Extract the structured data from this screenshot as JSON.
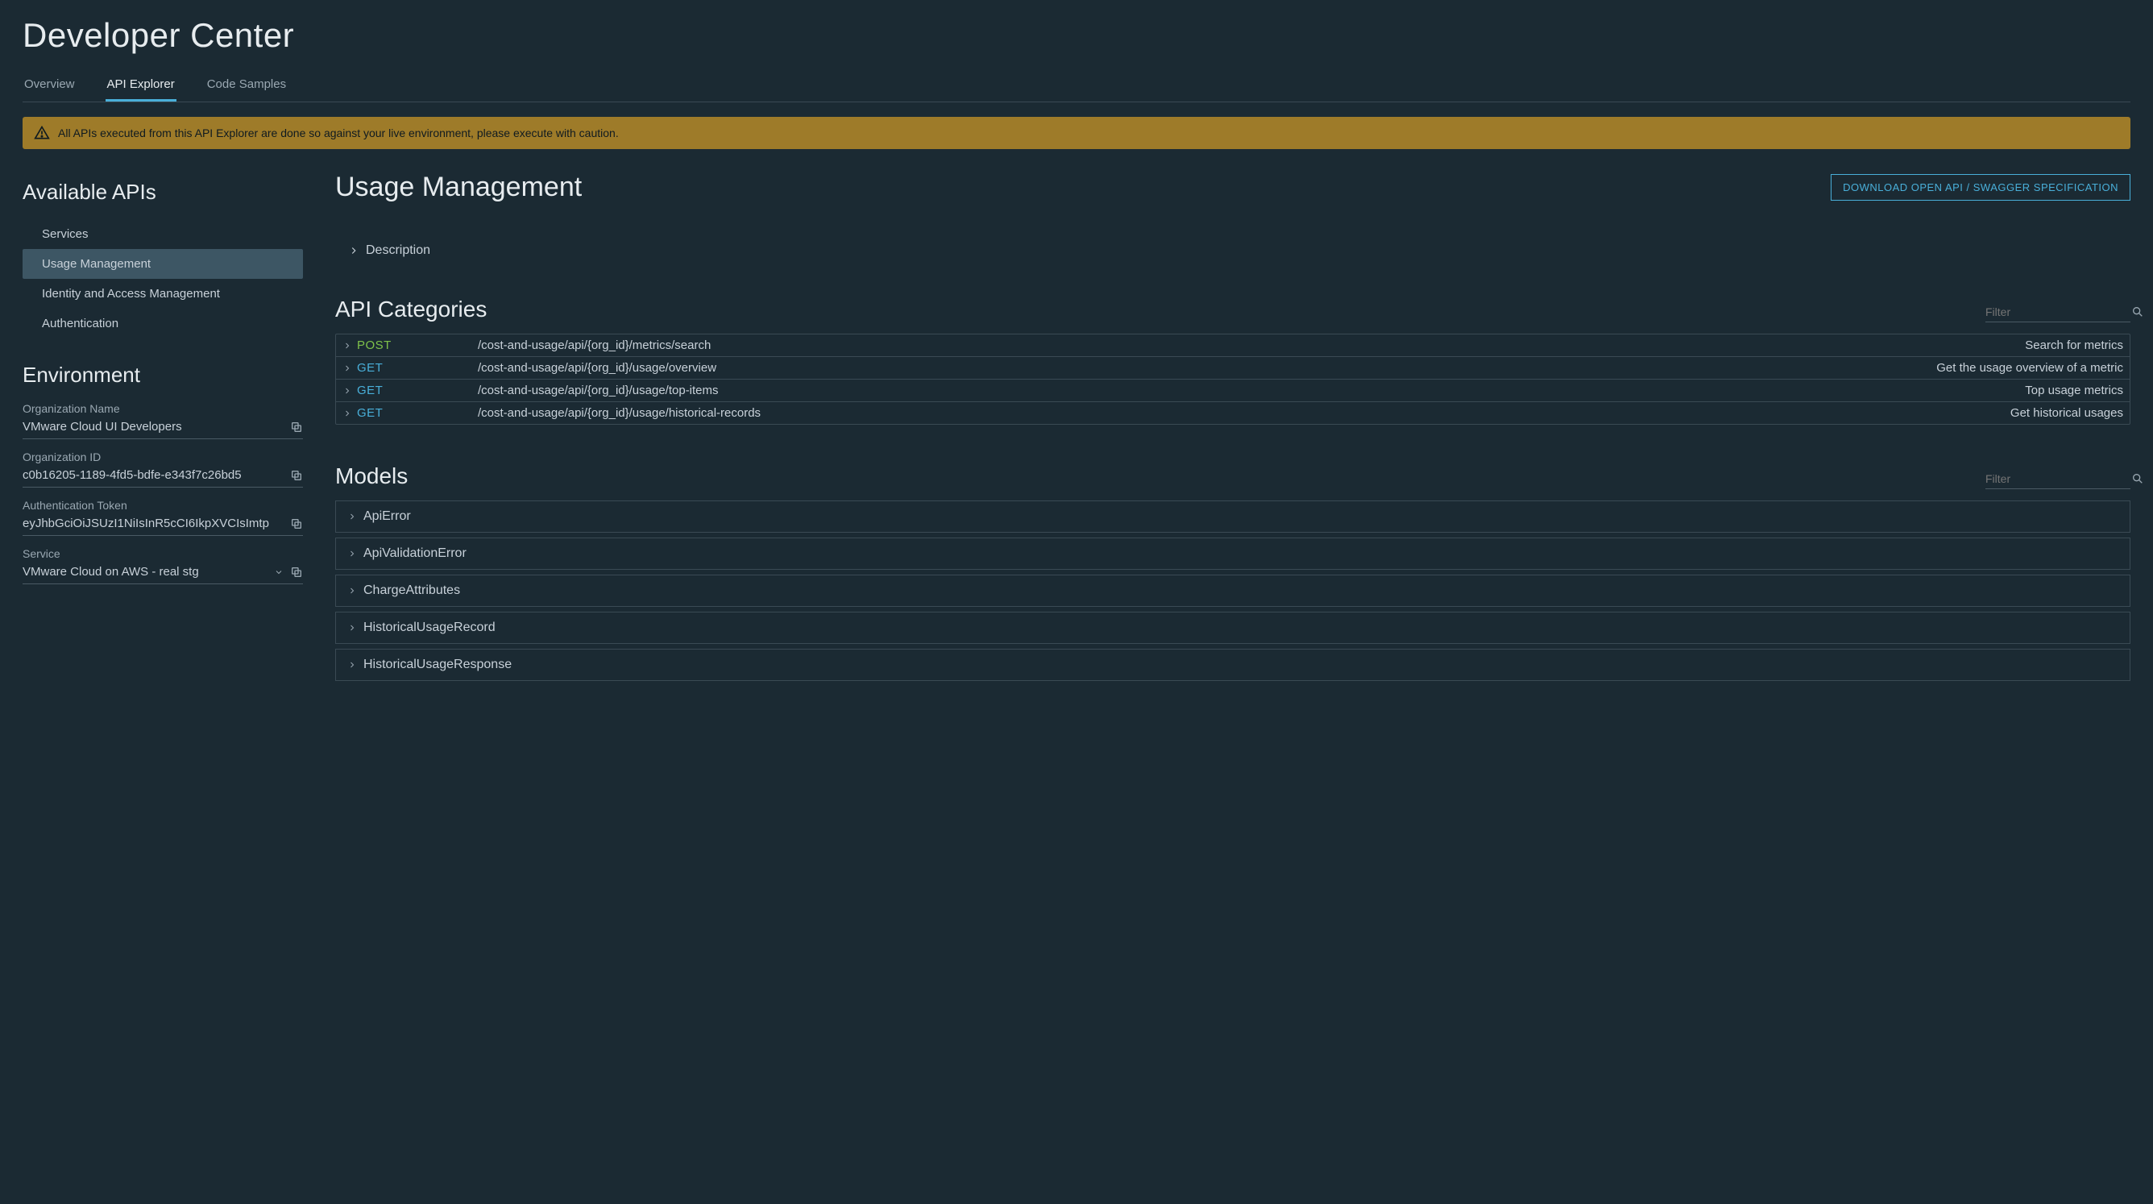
{
  "page_title": "Developer Center",
  "tabs": [
    "Overview",
    "API Explorer",
    "Code Samples"
  ],
  "active_tab": 1,
  "warning": "All APIs executed from this API Explorer are done so against your live environment, please execute with caution.",
  "sidebar": {
    "available_apis_heading": "Available APIs",
    "apis": [
      "Services",
      "Usage Management",
      "Identity and Access Management",
      "Authentication"
    ],
    "selected_api": 1,
    "environment_heading": "Environment",
    "fields": {
      "org_name_label": "Organization Name",
      "org_name_value": "VMware Cloud UI Developers",
      "org_id_label": "Organization ID",
      "org_id_value": "c0b16205-1189-4fd5-bdfe-e343f7c26bd5",
      "auth_token_label": "Authentication Token",
      "auth_token_value": "eyJhbGciOiJSUzI1NiIsInR5cCI6IkpXVCIsImtp",
      "service_label": "Service",
      "service_value": "VMware Cloud on AWS - real stg"
    }
  },
  "main": {
    "title": "Usage Management",
    "download_button": "DOWNLOAD OPEN API / SWAGGER SPECIFICATION",
    "description_label": "Description",
    "categories_heading": "API Categories",
    "filter_placeholder": "Filter",
    "endpoints": [
      {
        "method": "POST",
        "method_class": "post",
        "path": "/cost-and-usage/api/{org_id}/metrics/search",
        "summary": "Search for metrics"
      },
      {
        "method": "GET",
        "method_class": "get",
        "path": "/cost-and-usage/api/{org_id}/usage/overview",
        "summary": "Get the usage overview of a metric"
      },
      {
        "method": "GET",
        "method_class": "get",
        "path": "/cost-and-usage/api/{org_id}/usage/top-items",
        "summary": "Top usage metrics"
      },
      {
        "method": "GET",
        "method_class": "get",
        "path": "/cost-and-usage/api/{org_id}/usage/historical-records",
        "summary": "Get historical usages"
      }
    ],
    "models_heading": "Models",
    "models": [
      "ApiError",
      "ApiValidationError",
      "ChargeAttributes",
      "HistoricalUsageRecord",
      "HistoricalUsageResponse"
    ]
  }
}
